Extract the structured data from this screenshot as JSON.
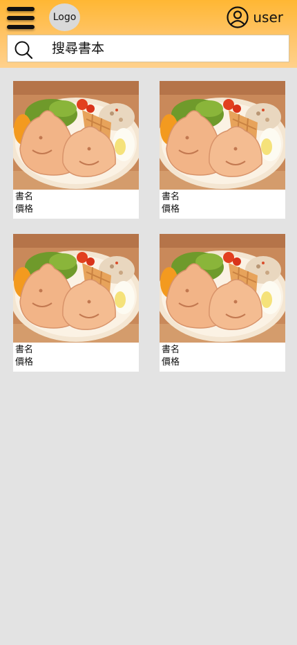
{
  "header": {
    "menu_icon": "hamburger-menu-icon",
    "logo_label": "Logo",
    "user_icon": "user-circle-icon",
    "user_label": "user",
    "colors": {
      "header_top": "#ffb733",
      "header_bottom": "#ffd18c"
    }
  },
  "search": {
    "icon": "search-icon",
    "placeholder": "搜尋書本",
    "value": ""
  },
  "books": [
    {
      "image": "book-cover-image",
      "title": "書名",
      "price": "價格"
    },
    {
      "image": "book-cover-image",
      "title": "書名",
      "price": "價格"
    },
    {
      "image": "book-cover-image",
      "title": "書名",
      "price": "價格"
    },
    {
      "image": "book-cover-image",
      "title": "書名",
      "price": "價格"
    }
  ]
}
